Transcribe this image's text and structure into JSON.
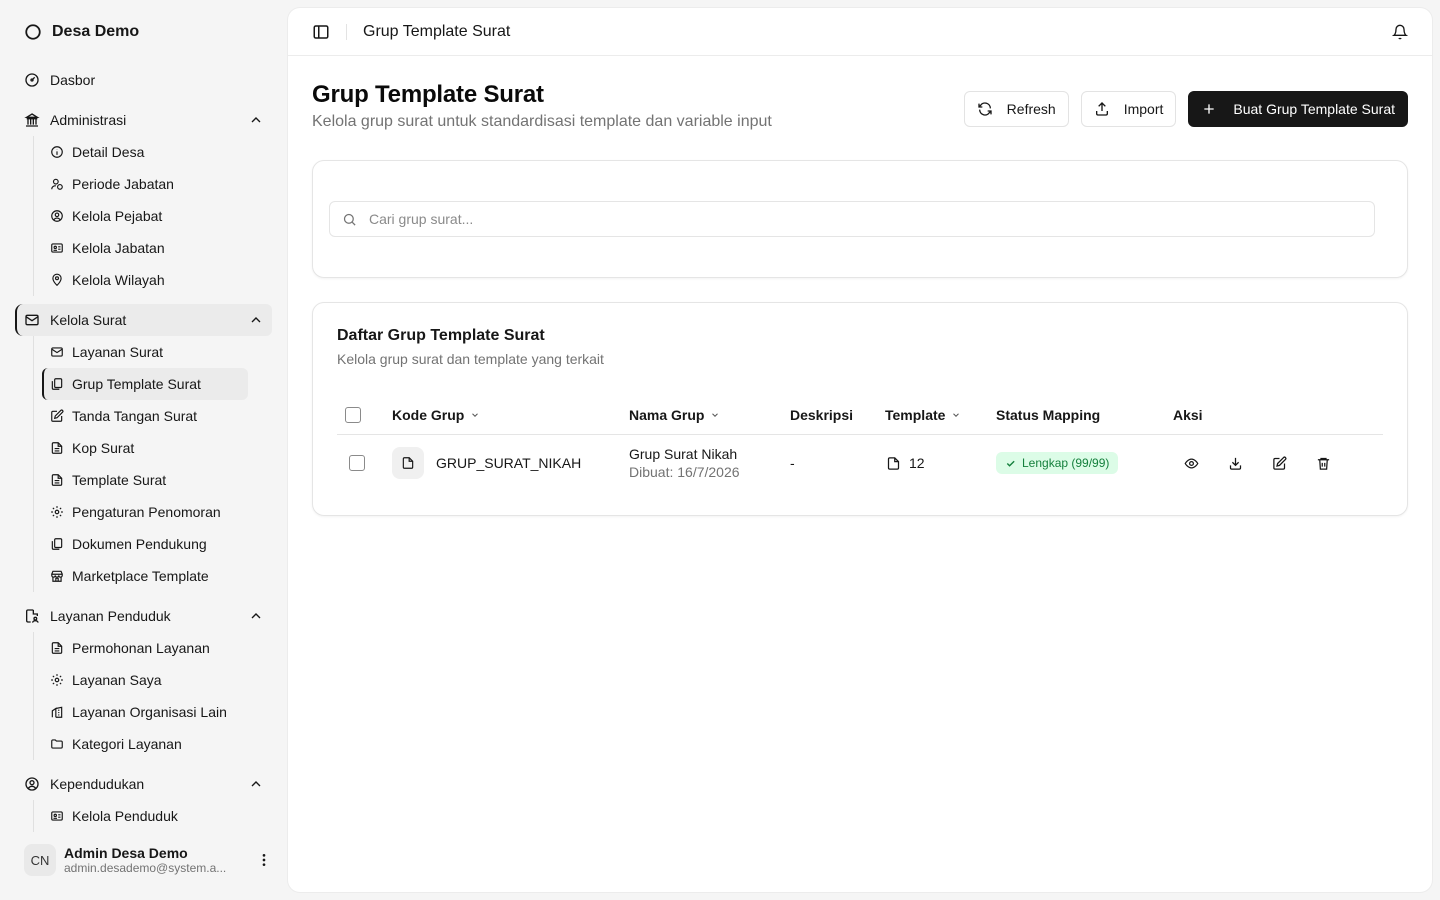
{
  "brand": {
    "name": "Desa Demo"
  },
  "nav": {
    "dashboard": "Dasbor",
    "sections": [
      {
        "label": "Administrasi",
        "items": [
          "Detail Desa",
          "Periode Jabatan",
          "Kelola Pejabat",
          "Kelola Jabatan",
          "Kelola Wilayah"
        ]
      },
      {
        "label": "Kelola Surat",
        "items": [
          "Layanan Surat",
          "Grup Template Surat",
          "Tanda Tangan Surat",
          "Kop Surat",
          "Template Surat",
          "Pengaturan Penomoran",
          "Dokumen Pendukung",
          "Marketplace Template"
        ]
      },
      {
        "label": "Layanan Penduduk",
        "items": [
          "Permohonan Layanan",
          "Layanan Saya",
          "Layanan Organisasi Lain",
          "Kategori Layanan"
        ]
      },
      {
        "label": "Kependudukan",
        "items": [
          "Kelola Penduduk"
        ]
      }
    ]
  },
  "user": {
    "initials": "CN",
    "name": "Admin Desa Demo",
    "email": "admin.desademo@system.a..."
  },
  "topbar": {
    "breadcrumb": "Grup Template Surat"
  },
  "page": {
    "title": "Grup Template Surat",
    "subtitle": "Kelola grup surat untuk standardisasi template dan variable input"
  },
  "actions": {
    "refresh": "Refresh",
    "import": "Import",
    "create": "Buat Grup Template Surat"
  },
  "search": {
    "placeholder": "Cari grup surat..."
  },
  "table": {
    "title": "Daftar Grup Template Surat",
    "subtitle": "Kelola grup surat dan template yang terkait",
    "headers": {
      "code": "Kode Grup",
      "name": "Nama Grup",
      "description": "Deskripsi",
      "template": "Template",
      "status": "Status Mapping",
      "actions": "Aksi"
    },
    "rows": [
      {
        "code": "GRUP_SURAT_NIKAH",
        "name": "Grup Surat Nikah",
        "created": "Dibuat: 16/7/2026",
        "description": "-",
        "template_count": "12",
        "status": "Lengkap (99/99)"
      }
    ]
  },
  "colors": {
    "primary": "#171717",
    "status_bg": "#dcfce7",
    "status_text": "#15803d",
    "muted": "#737373"
  }
}
